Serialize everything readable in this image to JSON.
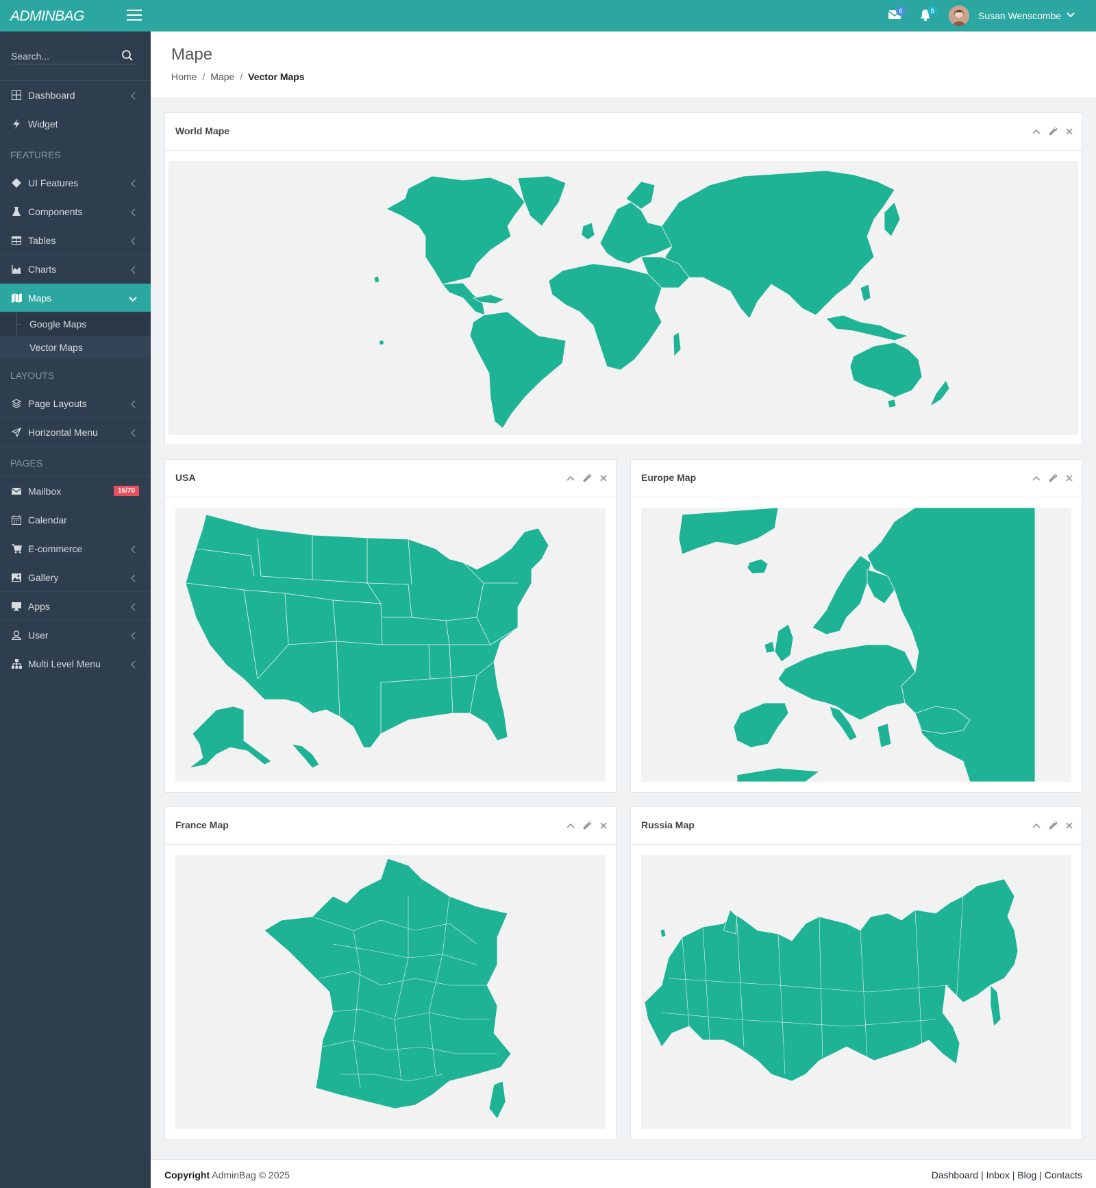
{
  "app": {
    "logo": "ADMINBAG"
  },
  "topbar": {
    "mail_count": "6",
    "notif_count": "8",
    "user_name": "Susan Wenscombe"
  },
  "sidebar": {
    "search_placeholder": "Search...",
    "items": {
      "dashboard": "Dashboard",
      "widget": "Widget",
      "features_heading": "FEATURES",
      "ui_features": "UI Features",
      "components": "Components",
      "tables": "Tables",
      "charts": "Charts",
      "maps": "Maps",
      "google_maps": "Google Maps",
      "vector_maps": "Vector Maps",
      "layouts_heading": "LAYOUTS",
      "page_layouts": "Page Layouts",
      "horizontal_menu": "Horizontal Menu",
      "pages_heading": "PAGES",
      "mailbox": "Mailbox",
      "mailbox_badge": "16/70",
      "calendar": "Calendar",
      "ecommerce": "E-commerce",
      "gallery": "Gallery",
      "apps": "Apps",
      "user": "User",
      "multi_level": "Multi Level Menu"
    }
  },
  "page": {
    "title": "Mape",
    "breadcrumb": [
      "Home",
      "Mape",
      "Vector Maps"
    ]
  },
  "cards": {
    "world": "World Mape",
    "usa": "USA",
    "europe": "Europe Map",
    "france": "France Map",
    "russia": "Russia Map"
  },
  "footer": {
    "copyright_label": "Copyright",
    "copyright_text": "AdminBag © 2025",
    "links": [
      "Dashboard",
      "Inbox",
      "Blog",
      "Contacts"
    ]
  },
  "colors": {
    "accent": "#2ba6a0",
    "map_fill": "#1db394",
    "sidebar_bg": "#2f3e4f",
    "badge_red": "#e9505d"
  }
}
